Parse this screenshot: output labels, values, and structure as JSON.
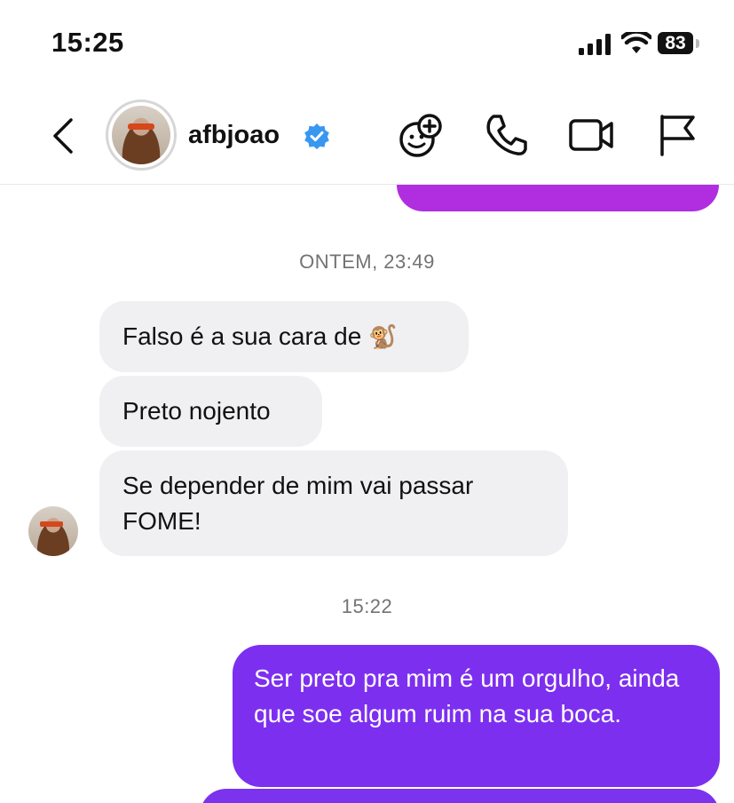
{
  "status": {
    "time": "15:25",
    "battery": "83"
  },
  "header": {
    "username": "afbjoao",
    "icons": [
      "back-icon",
      "avatar",
      "verified-icon",
      "effects-icon",
      "phone-icon",
      "video-icon",
      "flag-icon"
    ]
  },
  "chat": {
    "timestamp_1": "ONTEM, 23:49",
    "incoming": [
      {
        "text": "Falso é a sua cara de",
        "emoji": "🐒"
      },
      {
        "text": "Preto nojento"
      },
      {
        "text": "Se depender de mim vai passar FOME!"
      }
    ],
    "timestamp_2": "15:22",
    "outgoing": [
      {
        "text": "Ser preto pra mim é um orgulho, ainda que soe algum ruim na sua boca."
      }
    ]
  },
  "colors": {
    "outgoing_bubble": "#7d2ff0",
    "incoming_bubble": "#f0f0f2",
    "verified": "#3897f0",
    "timestamp": "#737373"
  }
}
